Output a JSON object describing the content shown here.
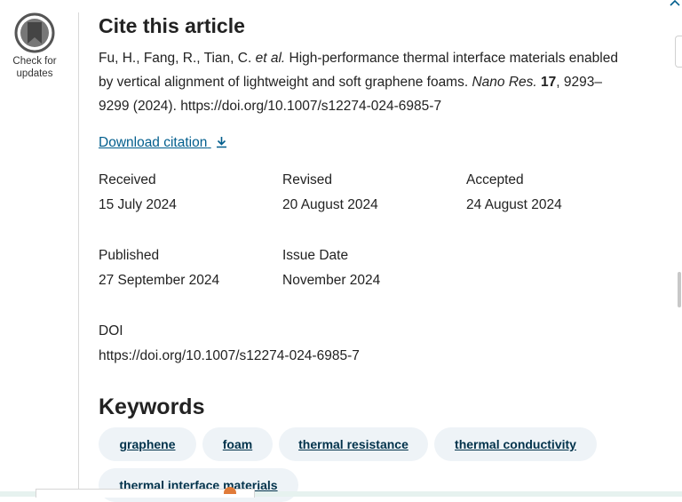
{
  "badge": {
    "label_line1": "Check for",
    "label_line2": "updates"
  },
  "cite": {
    "title": "Cite this article",
    "authors": "Fu, H., Fang, R., Tian, C.",
    "etal": "et al.",
    "article_title": "High-performance thermal interface materials enabled by vertical alignment of lightweight and soft graphene foams.",
    "journal": "Nano Res.",
    "volume": "17",
    "pages_year": ", 9293–9299 (2024). https://doi.org/10.1007/s12274-024-6985-7"
  },
  "download": {
    "label": "Download citation"
  },
  "dates": {
    "received_label": "Received",
    "received_value": "15 July 2024",
    "revised_label": "Revised",
    "revised_value": "20 August 2024",
    "accepted_label": "Accepted",
    "accepted_value": "24 August 2024",
    "published_label": "Published",
    "published_value": "27 September 2024",
    "issue_label": "Issue Date",
    "issue_value": "November 2024",
    "doi_label": "DOI",
    "doi_value": "https://doi.org/10.1007/s12274-024-6985-7"
  },
  "keywords": {
    "title": "Keywords",
    "items": [
      "graphene",
      "foam",
      "thermal resistance",
      "thermal conductivity",
      "thermal interface materials"
    ]
  },
  "colors": {
    "link": "#025e8d",
    "pill_bg": "#eef3f7",
    "pill_text": "#01324b"
  },
  "icons": {
    "badge": "bookmark-check-icon",
    "download": "download-icon"
  }
}
